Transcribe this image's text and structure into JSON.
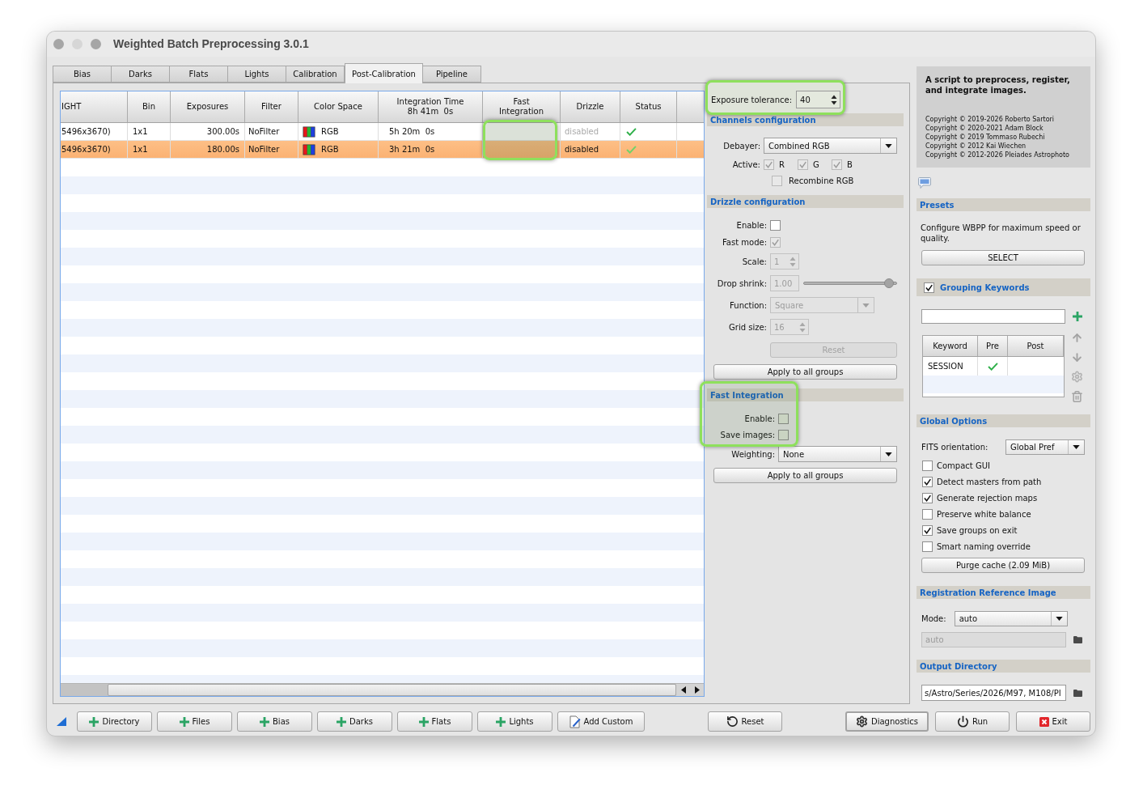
{
  "window": {
    "title": "Weighted Batch Preprocessing 3.0.1"
  },
  "tabs": [
    {
      "label": "Bias",
      "selected": false
    },
    {
      "label": "Darks",
      "selected": false
    },
    {
      "label": "Flats",
      "selected": false
    },
    {
      "label": "Lights",
      "selected": false
    },
    {
      "label": "Calibration",
      "selected": false
    },
    {
      "label": "Post-Calibration",
      "selected": true
    },
    {
      "label": "Pipeline",
      "selected": false
    }
  ],
  "table": {
    "columns": [
      {
        "label": "IGHT",
        "highlighted": false
      },
      {
        "label": "Bin",
        "highlighted": false
      },
      {
        "label": "Exposures",
        "highlighted": false
      },
      {
        "label": "Filter",
        "highlighted": false
      },
      {
        "label": "Color Space",
        "highlighted": false
      },
      {
        "label": "Integration Time",
        "sublabel": "8h 41m  0s",
        "highlighted": false
      },
      {
        "label": "Fast Integration",
        "highlighted": true
      },
      {
        "label": "Drizzle",
        "highlighted": false
      },
      {
        "label": "Status",
        "highlighted": false
      }
    ],
    "rows": [
      {
        "selected": false,
        "column_1": "5496x3670)",
        "bin": "1x1",
        "exposures": "300.00s",
        "filter": "NoFilter",
        "color_space": "RGB",
        "integration_time": "5h 20m  0s",
        "drizzle": "disabled",
        "status_ok": true
      },
      {
        "selected": true,
        "column_1": "5496x3670)",
        "bin": "1x1",
        "exposures": "180.00s",
        "filter": "NoFilter",
        "color_space": "RGB",
        "integration_time": "3h 21m  0s",
        "drizzle": "disabled",
        "status_ok": true
      }
    ]
  },
  "exposure_tolerance": {
    "label": "Exposure tolerance:",
    "value": "40",
    "highlighted": true
  },
  "channels_configuration": {
    "title": "Channels configuration",
    "debayer": {
      "label": "Debayer:",
      "value": "Combined RGB"
    },
    "active": {
      "label": "Active:",
      "channels": [
        {
          "label": "R",
          "checked": true,
          "disabled": true
        },
        {
          "label": "G",
          "checked": true,
          "disabled": true
        },
        {
          "label": "B",
          "checked": true,
          "disabled": true
        }
      ]
    },
    "recombine_rgb": {
      "label": "Recombine RGB",
      "checked": false,
      "disabled": true
    }
  },
  "drizzle_configuration": {
    "title": "Drizzle configuration",
    "fields": [
      {
        "kind": "checkbox",
        "label": "Enable:",
        "checked": false,
        "disabled": false
      },
      {
        "kind": "checkbox",
        "label": "Fast mode:",
        "checked": true,
        "disabled": true
      },
      {
        "kind": "spinbox",
        "label": "Scale:",
        "value": "1",
        "disabled": true
      },
      {
        "kind": "slider",
        "label": "Drop shrink:",
        "value": "1.00",
        "level": 0.92,
        "disabled": true
      },
      {
        "kind": "dropdown",
        "label": "Function:",
        "value": "Square",
        "disabled": true
      },
      {
        "kind": "spinbox",
        "label": "Grid size:",
        "value": "16",
        "disabled": true
      }
    ],
    "reset_button": {
      "label": "Reset",
      "disabled": true
    },
    "apply_button": {
      "label": "Apply to all groups",
      "disabled": false
    }
  },
  "fast_integration": {
    "title": "Fast Integration",
    "highlighted": true,
    "enable": {
      "label": "Enable:",
      "checked": false
    },
    "save_images": {
      "label": "Save images:",
      "checked": false
    },
    "weighting": {
      "label": "Weighting:",
      "value": "None"
    },
    "apply_button": {
      "label": "Apply to all groups",
      "disabled": false
    }
  },
  "about": {
    "summary": "A script to preprocess, register, and integrate images.",
    "copyrights": [
      "Copyright © 2019-2026 Roberto Sartori",
      "Copyright © 2020-2021 Adam Block",
      "Copyright © 2019 Tommaso Rubechi",
      "Copyright © 2012 Kai Wiechen",
      "Copyright © 2012-2026 Pleiades Astrophoto"
    ]
  },
  "presets": {
    "title": "Presets",
    "description": "Configure WBPP for maximum speed or quality.",
    "button": "SELECT"
  },
  "grouping_keywords": {
    "title": "Grouping Keywords",
    "checked": true,
    "columns": [
      "Keyword",
      "Pre",
      "Post"
    ],
    "rows": [
      {
        "keyword": "SESSION",
        "pre": true,
        "post": false
      }
    ]
  },
  "global_options": {
    "title": "Global Options",
    "fits_orientation": {
      "label": "FITS orientation:",
      "value": "Global Pref"
    },
    "options": [
      {
        "label": "Compact GUI",
        "checked": false
      },
      {
        "label": "Detect masters from path",
        "checked": true
      },
      {
        "label": "Generate rejection maps",
        "checked": true
      },
      {
        "label": "Preserve white balance",
        "checked": false
      },
      {
        "label": "Save groups on exit",
        "checked": true
      },
      {
        "label": "Smart naming override",
        "checked": false
      }
    ],
    "purge_button": "Purge cache (2.09 MiB)"
  },
  "registration_reference_image": {
    "title": "Registration Reference Image",
    "mode": {
      "label": "Mode:",
      "value": "auto"
    },
    "image_path": {
      "value": "auto",
      "disabled": true
    }
  },
  "output_directory": {
    "title": "Output Directory",
    "path": "s/Astro/Series/2026/M97, M108/PI"
  },
  "toolbar": {
    "add_buttons": [
      {
        "label": "Directory",
        "kind": "add"
      },
      {
        "label": "Files",
        "kind": "add"
      },
      {
        "label": "Bias",
        "kind": "add"
      },
      {
        "label": "Darks",
        "kind": "add"
      },
      {
        "label": "Flats",
        "kind": "add"
      },
      {
        "label": "Lights",
        "kind": "add"
      },
      {
        "label": "Add Custom",
        "kind": "custom"
      }
    ],
    "reset_button": {
      "label": "Reset",
      "kind": "reset"
    },
    "action_buttons": [
      {
        "label": "Diagnostics",
        "kind": "diagnostics",
        "focused": true
      },
      {
        "label": "Run",
        "kind": "run",
        "focused": false
      },
      {
        "label": "Exit",
        "kind": "exit",
        "focused": false
      }
    ]
  }
}
